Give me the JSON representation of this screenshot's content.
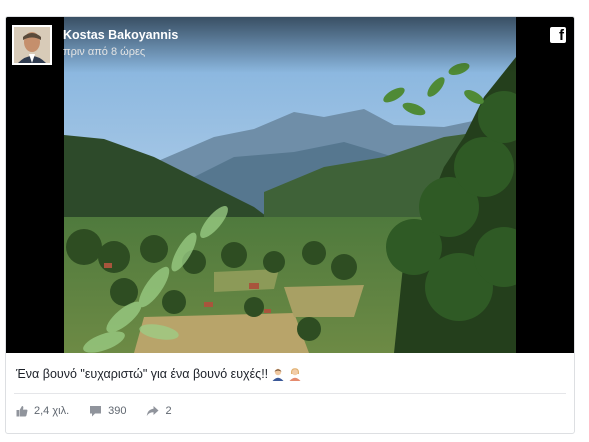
{
  "post": {
    "author": "Kostas Bakoyannis",
    "timestamp": "πριν από 8 ώρες",
    "caption": "Ένα βουνό \"ευχαριστώ\" για ένα βουνό ευχές!!",
    "caption_emojis": [
      "man-emoji",
      "woman-emoji"
    ]
  },
  "stats": {
    "likes": "2,4 χιλ.",
    "comments": "390",
    "shares": "2"
  },
  "colors": {
    "sky": "#9ec3e4",
    "mountain": "#4d6e8a",
    "forest": "#2f4a25",
    "field": "#b5a36a",
    "icon_gray": "#90949c"
  }
}
